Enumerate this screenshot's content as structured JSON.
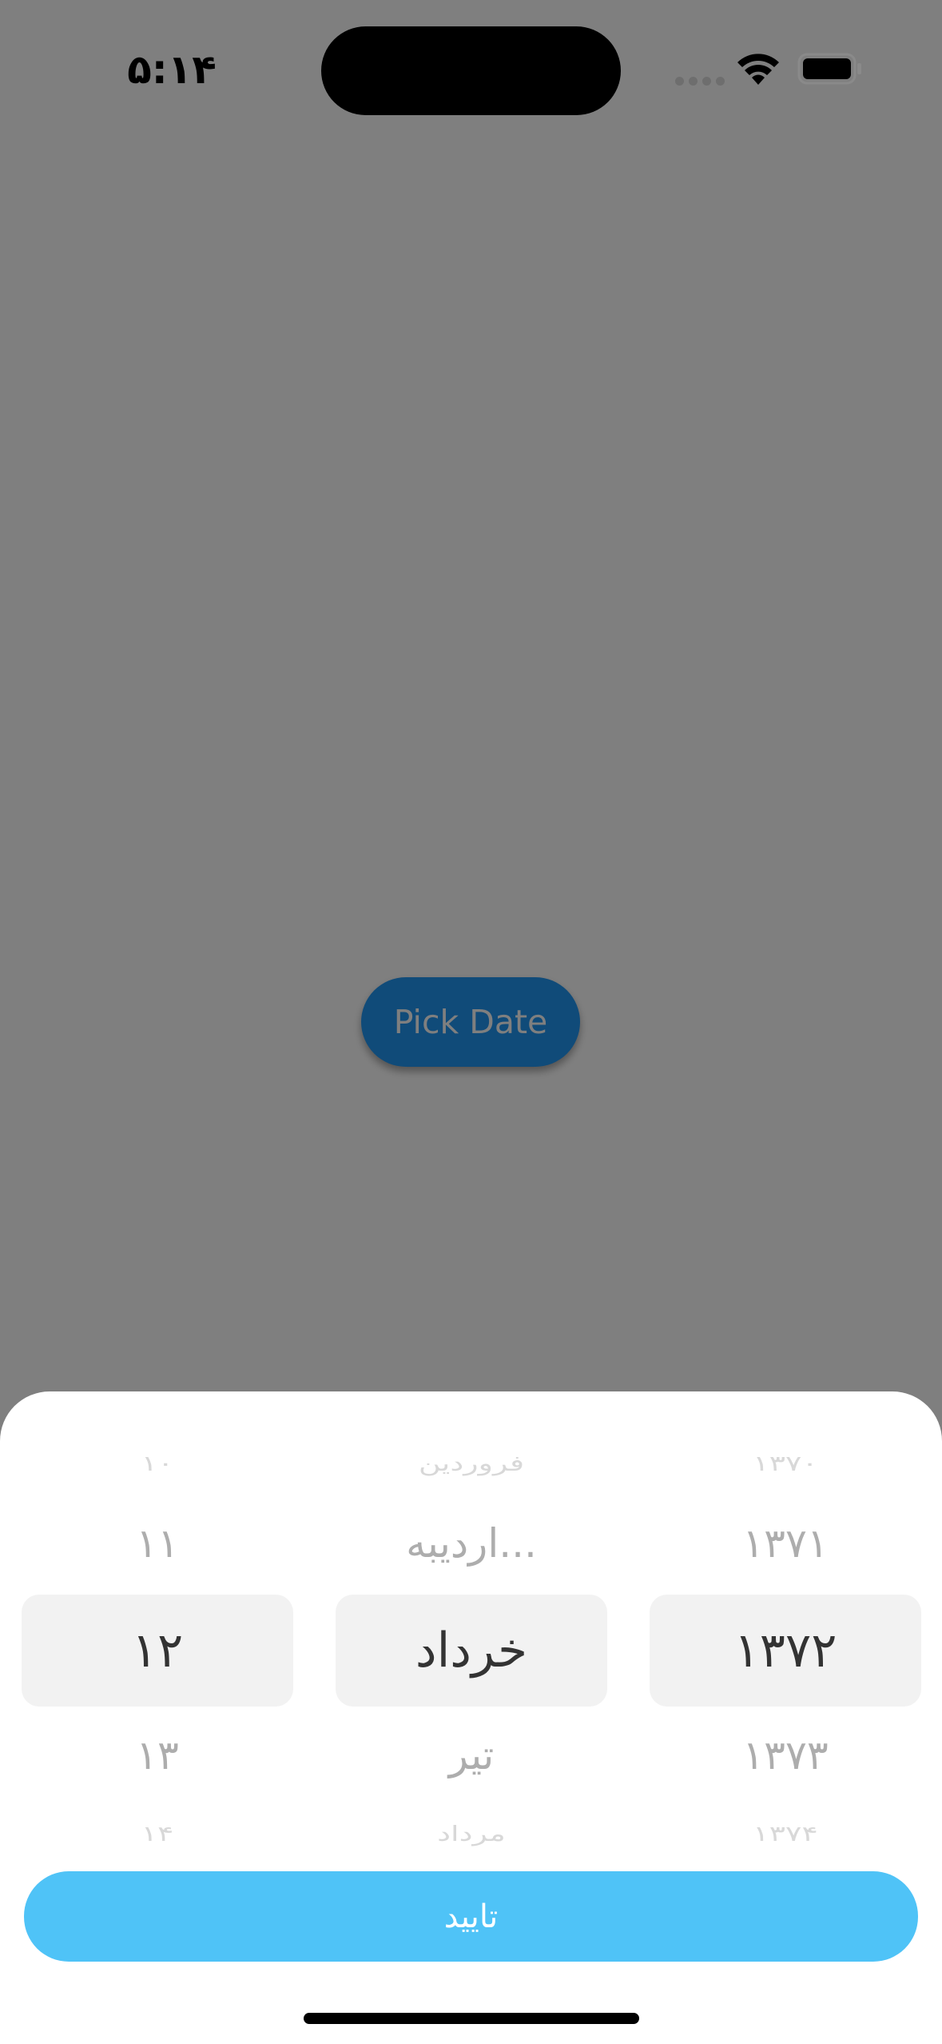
{
  "status_bar": {
    "time": "۵:۱۴",
    "icons": [
      "cellular-signal-icon",
      "wifi-icon",
      "battery-icon"
    ]
  },
  "main": {
    "pick_button_label": "Pick Date"
  },
  "picker": {
    "day": {
      "items": [
        "۱۰",
        "۱۱",
        "۱۲",
        "۱۳",
        "۱۴"
      ],
      "selected": "۱۲"
    },
    "month": {
      "items": [
        "فروردین",
        "اردیبه...",
        "خرداد",
        "تیر",
        "مرداد"
      ],
      "selected": "خرداد"
    },
    "year": {
      "items": [
        "۱۳۷۰",
        "۱۳۷۱",
        "۱۳۷۲",
        "۱۳۷۳",
        "۱۳۷۴"
      ],
      "selected": "۱۳۷۲"
    },
    "confirm_label": "تایید"
  },
  "colors": {
    "accent_button": "#4fc3f7",
    "app_button": "#2196f3",
    "scrim": "rgba(0,0,0,0.5)"
  }
}
